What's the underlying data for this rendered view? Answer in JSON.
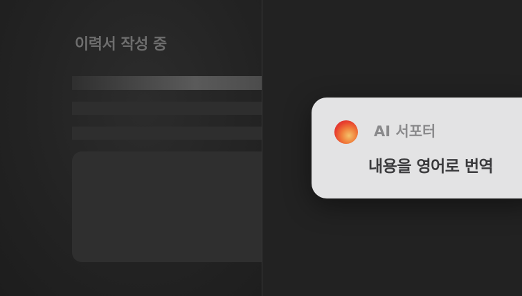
{
  "editor": {
    "title": "이력서 작성 중"
  },
  "notification": {
    "sender": "AI 서포터",
    "message": "내용을 영어로 번역"
  },
  "colors": {
    "background": "#202020",
    "card": "#e3e3e4",
    "icon_gradient": [
      "#f4c16a",
      "#f07f3b",
      "#e8412e",
      "#d2213a"
    ]
  },
  "icons": {
    "assistant": "ai-assistant-orb-icon"
  }
}
